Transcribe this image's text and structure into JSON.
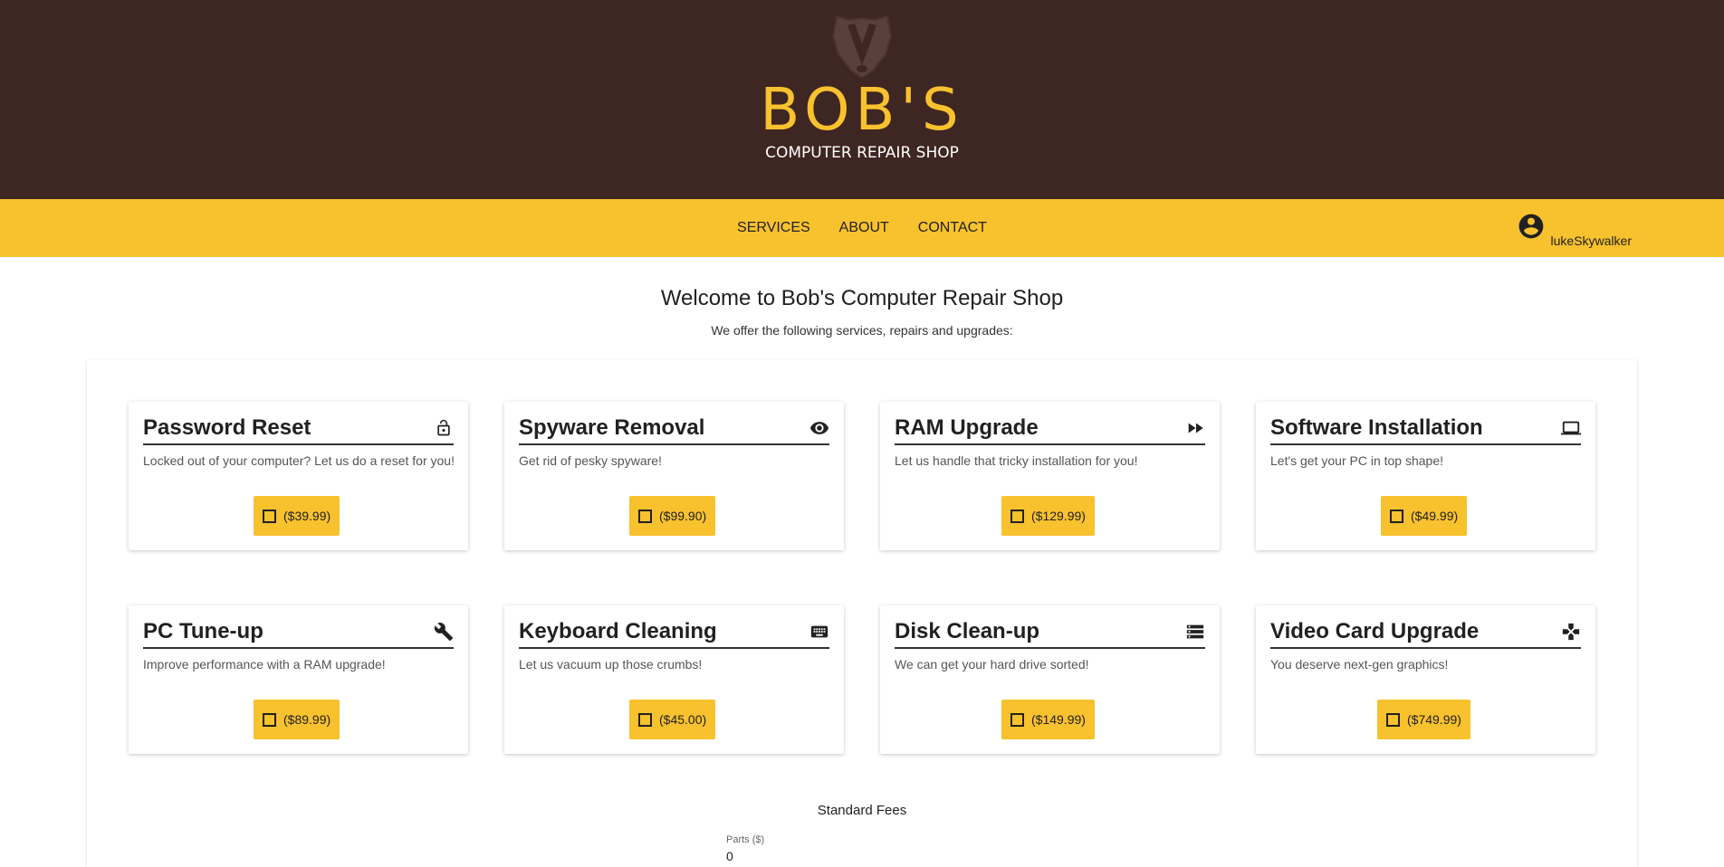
{
  "header": {
    "logo_icon": "badger-head-icon",
    "brand": "BOB'S",
    "tagline": "COMPUTER REPAIR SHOP"
  },
  "nav": {
    "links": [
      "SERVICES",
      "ABOUT",
      "CONTACT"
    ],
    "user_icon": "account-circle-icon",
    "username": "lukeSkywalker"
  },
  "main": {
    "welcome": "Welcome to Bob's Computer Repair Shop",
    "offer": "We offer the following services, repairs and upgrades:"
  },
  "services": [
    {
      "title": "Password Reset",
      "icon": "lock-open-icon",
      "desc": "Locked out of your computer? Let us do a reset for you!",
      "price": "($39.99)"
    },
    {
      "title": "Spyware Removal",
      "icon": "eye-icon",
      "desc": "Get rid of pesky spyware!",
      "price": "($99.90)"
    },
    {
      "title": "RAM Upgrade",
      "icon": "fast-forward-icon",
      "desc": "Let us handle that tricky installation for you!",
      "price": "($129.99)"
    },
    {
      "title": "Software Installation",
      "icon": "laptop-icon",
      "desc": "Let's get your PC in top shape!",
      "price": "($49.99)"
    },
    {
      "title": "PC Tune-up",
      "icon": "wrench-icon",
      "desc": "Improve performance with a RAM upgrade!",
      "price": "($89.99)"
    },
    {
      "title": "Keyboard Cleaning",
      "icon": "keyboard-icon",
      "desc": "Let us vacuum up those crumbs!",
      "price": "($45.00)"
    },
    {
      "title": "Disk Clean-up",
      "icon": "storage-icon",
      "desc": "We can get your hard drive sorted!",
      "price": "($149.99)"
    },
    {
      "title": "Video Card Upgrade",
      "icon": "gamepad-icon",
      "desc": "You deserve next-gen graphics!",
      "price": "($749.99)"
    }
  ],
  "fees": {
    "title": "Standard Fees",
    "parts_label": "Parts ($)",
    "parts_value": "0"
  },
  "colors": {
    "header_bg": "#3e2622",
    "accent": "#f8c12e"
  }
}
